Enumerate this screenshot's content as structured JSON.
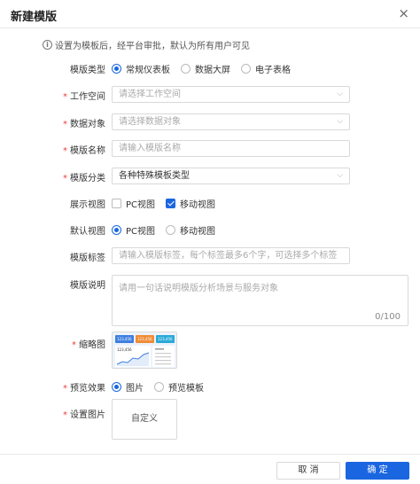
{
  "dialog": {
    "title": "新建模版",
    "close": "×"
  },
  "notice": {
    "text": "设置为模板后，经平台审批，默认为所有用户可见"
  },
  "template_type": {
    "label": "模版类型",
    "options": [
      "常规仪表板",
      "数据大屏",
      "电子表格"
    ],
    "selected": "常规仪表板"
  },
  "workspace": {
    "label": "工作空间",
    "placeholder": "请选择工作空间"
  },
  "data_object": {
    "label": "数据对象",
    "placeholder": "请选择数据对象"
  },
  "template_name": {
    "label": "模版名称",
    "placeholder": "请输入模版名称"
  },
  "category": {
    "label": "模版分类",
    "value": "各种特殊模板类型"
  },
  "display_view": {
    "label": "展示视图",
    "options": [
      {
        "label": "PC视图",
        "checked": false
      },
      {
        "label": "移动视图",
        "checked": true
      }
    ]
  },
  "default_view": {
    "label": "默认视图",
    "options": [
      "PC视图",
      "移动视图"
    ],
    "selected": "PC视图"
  },
  "tags": {
    "label": "模版标签",
    "placeholder": "请输入模版标签，每个标签最多6个字，可选择多个标签"
  },
  "description": {
    "label": "模版说明",
    "placeholder": "请用一句话说明模版分析场景与服务对象",
    "counter": "0/100"
  },
  "thumbnail": {
    "label": "缩略图",
    "card_values": [
      "123,456",
      "123,456",
      "123,456"
    ],
    "panel_value": "123,456"
  },
  "preview": {
    "label": "预览效果",
    "options": [
      "图片",
      "预览模板"
    ],
    "selected": "图片"
  },
  "set_image": {
    "label": "设置图片",
    "button": "自定义"
  },
  "footer": {
    "cancel": "取 消",
    "confirm": "确 定"
  },
  "colors": {
    "accent": "#1a66e0",
    "required": "#e8403a",
    "card_orange": "#f08c36",
    "card_cyan": "#29a9d8"
  },
  "icons": {
    "close": "close-icon",
    "info": "info-icon",
    "dropdown": "chevron-down-icon"
  }
}
